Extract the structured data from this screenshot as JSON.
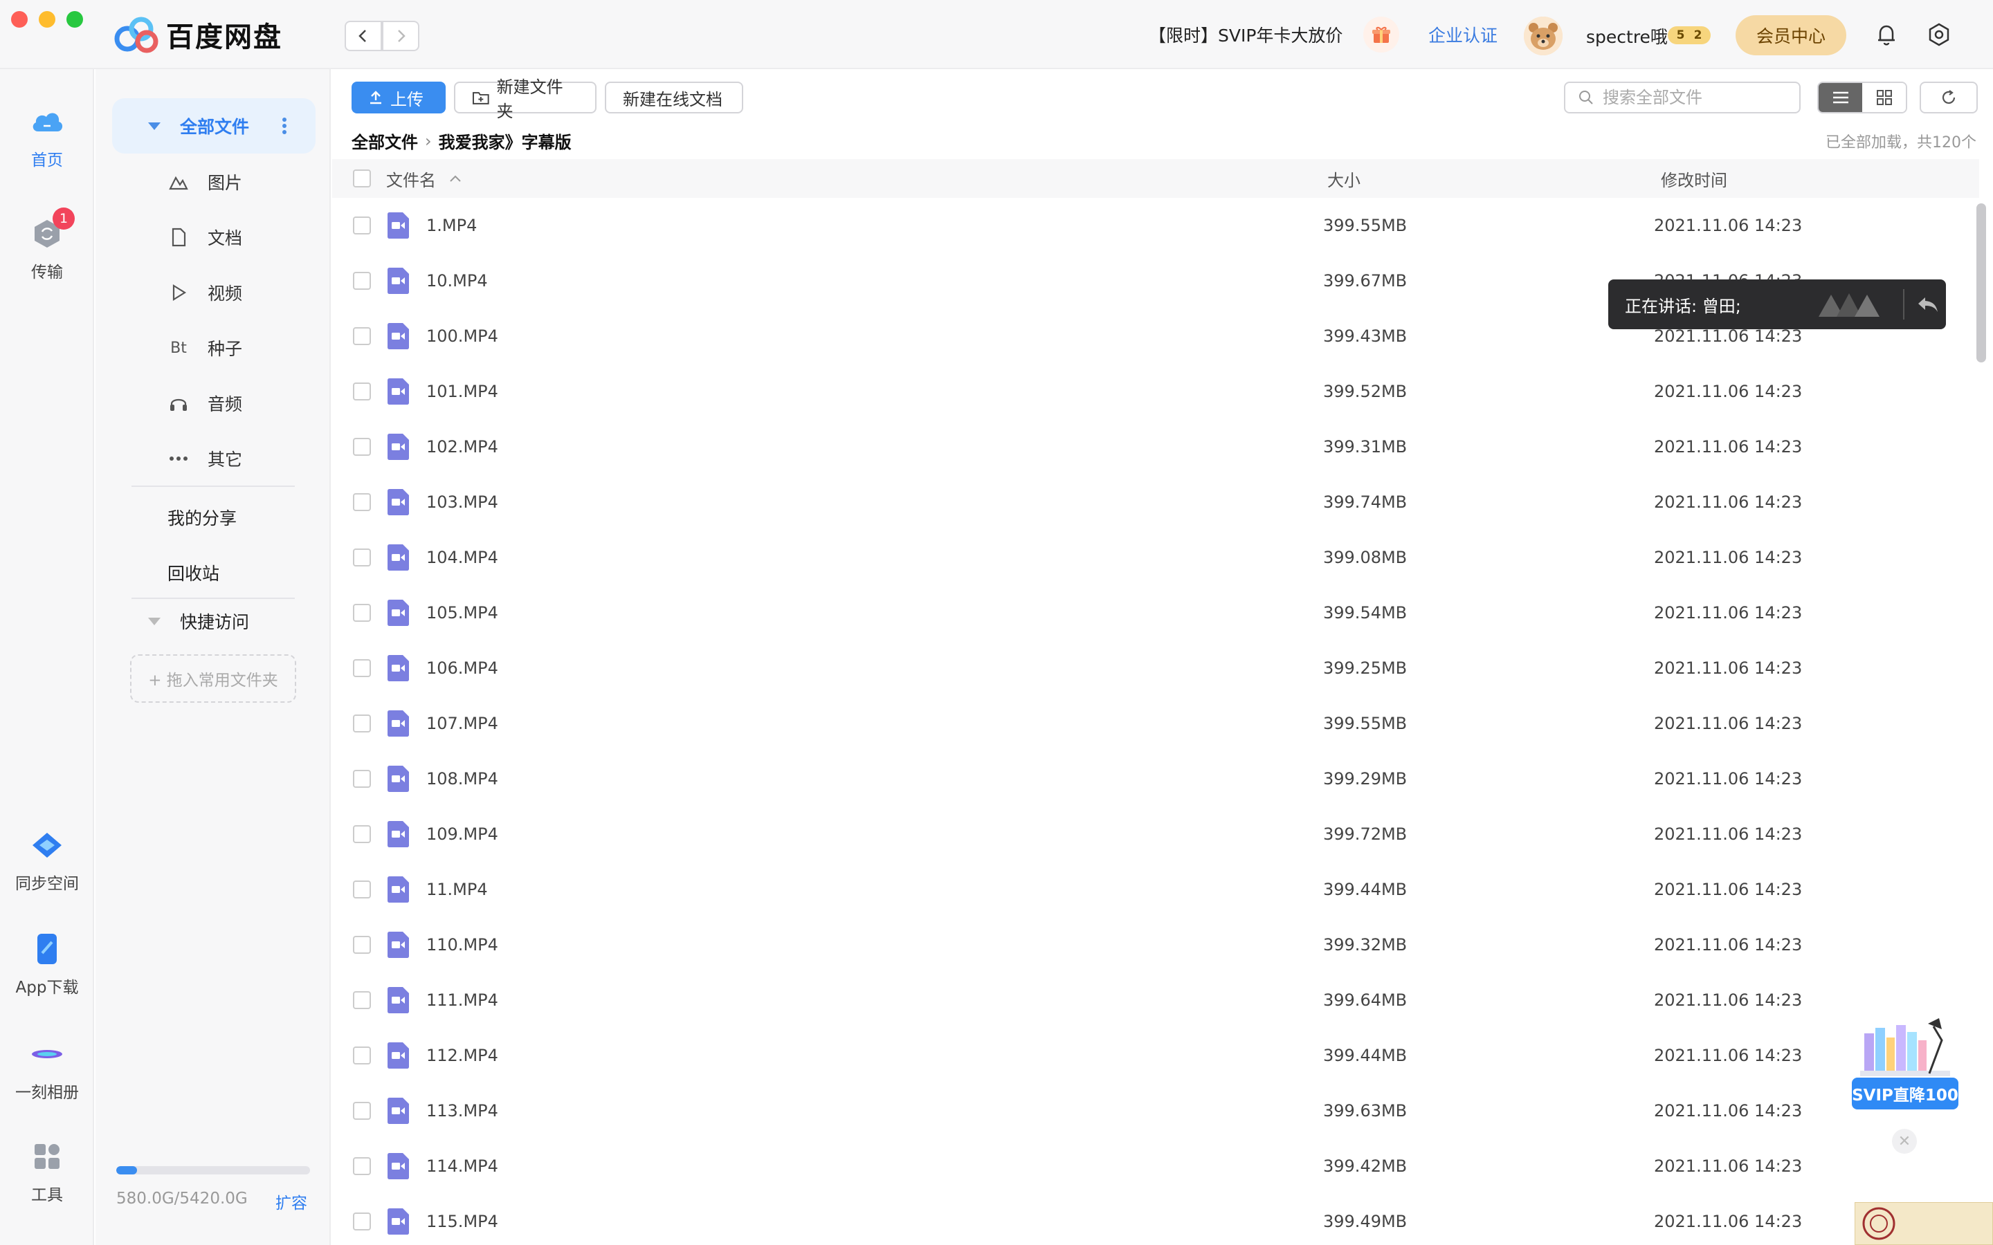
{
  "app": {
    "name": "百度网盘"
  },
  "header": {
    "promo": "【限时】SVIP年卡大放价",
    "enterprise": "企业认证",
    "username": "spectre哦",
    "vip_level_a": "5",
    "vip_level_b": "2",
    "member_center": "会员中心"
  },
  "rail": {
    "home": "首页",
    "transfer": "传输",
    "transfer_badge": "1",
    "sync": "同步空间",
    "app_download": "App下载",
    "album": "一刻相册",
    "tools": "工具"
  },
  "sidebar": {
    "all_files": "全部文件",
    "categories": [
      {
        "label": "图片",
        "icon": "image-icon"
      },
      {
        "label": "文档",
        "icon": "document-icon"
      },
      {
        "label": "视频",
        "icon": "video-icon"
      },
      {
        "label": "种子",
        "icon": "torrent-icon"
      },
      {
        "label": "音频",
        "icon": "audio-icon"
      },
      {
        "label": "其它",
        "icon": "more-icon"
      }
    ],
    "my_share": "我的分享",
    "recycle": "回收站",
    "quick_access": "快捷访问",
    "drop_zone": "+ 拖入常用文件夹",
    "storage": "580.0G/5420.0G",
    "storage_used_fraction": 0.107,
    "expand": "扩容",
    "torrent_glyph": "Bt"
  },
  "toolbar": {
    "upload": "上传",
    "new_folder": "新建文件夹",
    "new_online_doc": "新建在线文档",
    "search_placeholder": "搜索全部文件"
  },
  "breadcrumb": {
    "root": "全部文件",
    "current": "我爱我家》字幕版"
  },
  "loaded_info": "已全部加载，共120个",
  "table": {
    "col_name": "文件名",
    "col_size": "大小",
    "col_time": "修改时间",
    "rows": [
      {
        "name": "1.MP4",
        "size": "399.55MB",
        "time": "2021.11.06 14:23"
      },
      {
        "name": "10.MP4",
        "size": "399.67MB",
        "time": "2021.11.06 14:23"
      },
      {
        "name": "100.MP4",
        "size": "399.43MB",
        "time": "2021.11.06 14:23"
      },
      {
        "name": "101.MP4",
        "size": "399.52MB",
        "time": "2021.11.06 14:23"
      },
      {
        "name": "102.MP4",
        "size": "399.31MB",
        "time": "2021.11.06 14:23"
      },
      {
        "name": "103.MP4",
        "size": "399.74MB",
        "time": "2021.11.06 14:23"
      },
      {
        "name": "104.MP4",
        "size": "399.08MB",
        "time": "2021.11.06 14:23"
      },
      {
        "name": "105.MP4",
        "size": "399.54MB",
        "time": "2021.11.06 14:23"
      },
      {
        "name": "106.MP4",
        "size": "399.25MB",
        "time": "2021.11.06 14:23"
      },
      {
        "name": "107.MP4",
        "size": "399.55MB",
        "time": "2021.11.06 14:23"
      },
      {
        "name": "108.MP4",
        "size": "399.29MB",
        "time": "2021.11.06 14:23"
      },
      {
        "name": "109.MP4",
        "size": "399.72MB",
        "time": "2021.11.06 14:23"
      },
      {
        "name": "11.MP4",
        "size": "399.44MB",
        "time": "2021.11.06 14:23"
      },
      {
        "name": "110.MP4",
        "size": "399.32MB",
        "time": "2021.11.06 14:23"
      },
      {
        "name": "111.MP4",
        "size": "399.64MB",
        "time": "2021.11.06 14:23"
      },
      {
        "name": "112.MP4",
        "size": "399.44MB",
        "time": "2021.11.06 14:23"
      },
      {
        "name": "113.MP4",
        "size": "399.63MB",
        "time": "2021.11.06 14:23"
      },
      {
        "name": "114.MP4",
        "size": "399.42MB",
        "time": "2021.11.06 14:23"
      },
      {
        "name": "115.MP4",
        "size": "399.49MB",
        "time": "2021.11.06 14:23"
      }
    ]
  },
  "speaking_toast": "正在讲话: 曾田;",
  "promo_float": "SVIP直降100",
  "colors": {
    "accent": "#3a8df0",
    "video_icon": "#7b7fe0",
    "badge_red": "#f2445b"
  }
}
